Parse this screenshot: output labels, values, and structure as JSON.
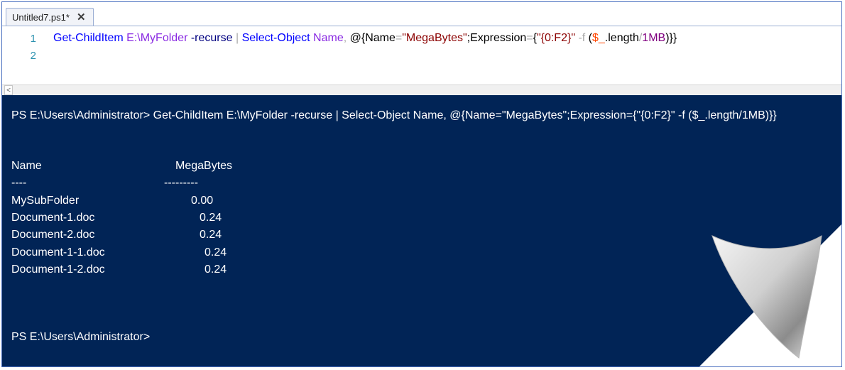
{
  "tab": {
    "title": "Untitled7.ps1*",
    "close_glyph": "✕"
  },
  "editor": {
    "line_numbers": [
      "1",
      "2"
    ],
    "tokens": {
      "t1": "Get-ChildItem",
      "t2": " E:\\MyFolder",
      "t3": " -recurse",
      "t4": " |",
      "t5": " Select-Object",
      "t6": " Name",
      "t7": ",",
      "t8": " @{",
      "t9": "Name",
      "t10": "=",
      "t11": "\"MegaBytes\"",
      "t12": ";Expression",
      "t13": "=",
      "t14": "{",
      "t15": "\"{0:F2}\"",
      "t16": " -f",
      "t17": " (",
      "t18": "$_",
      "t19": ".length",
      "t20": "/",
      "t21": "1MB",
      "t22": ")}}"
    }
  },
  "scrollbar": {
    "left_arrow": "<"
  },
  "console": {
    "command_line": "PS E:\\Users\\Administrator> Get-ChildItem E:\\MyFolder -recurse | Select-Object Name, @{Name=\"MegaBytes\";Expression={\"{0:F2}\" -f ($_.length/1MB)}}",
    "headers": {
      "name": "Name",
      "mb": "MegaBytes"
    },
    "separators": {
      "name": "----",
      "mb": "---------"
    },
    "rows": [
      {
        "name": "MySubFolder",
        "mb": "0.00"
      },
      {
        "name": "Document-1.doc",
        "mb": "0.24"
      },
      {
        "name": "Document-2.doc",
        "mb": "0.24"
      },
      {
        "name": "Document-1-1.doc",
        "mb": "0.24"
      },
      {
        "name": "Document-1-2.doc",
        "mb": "0.24"
      }
    ],
    "prompt": "PS E:\\Users\\Administrator>"
  },
  "colors": {
    "console_bg": "#012456",
    "cmd": "#0000ff",
    "string": "#8b0000",
    "variable": "#ff4500",
    "number": "#800080"
  },
  "icons": {
    "tab_close": "close-icon",
    "scroll_left": "chevron-left-icon",
    "page_curl": "page-curl-decoration"
  }
}
